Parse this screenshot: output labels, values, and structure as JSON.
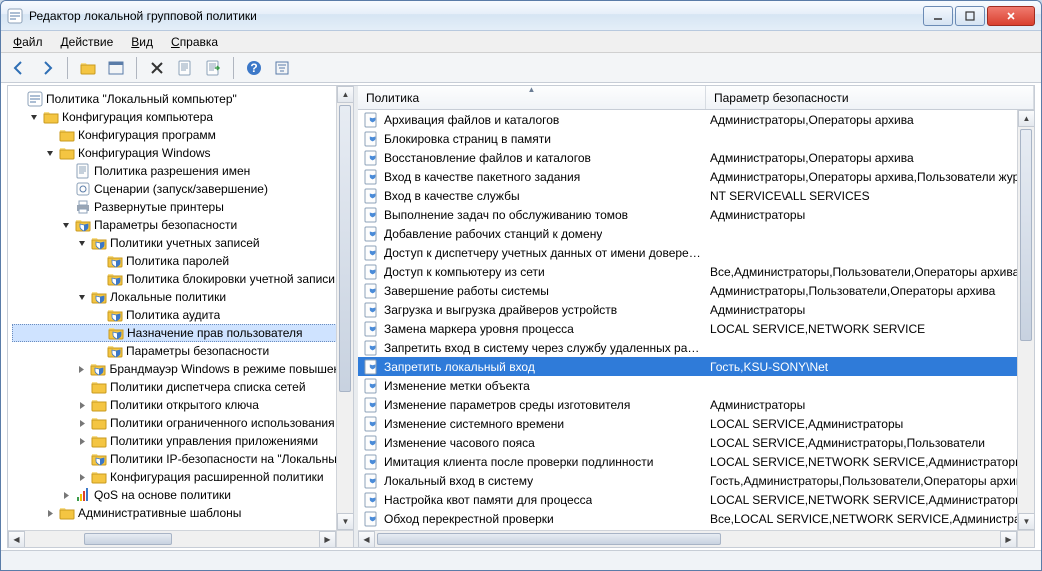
{
  "window": {
    "title": "Редактор локальной групповой политики"
  },
  "menu": {
    "file": "Файл",
    "action": "Действие",
    "view": "Вид",
    "help": "Справка"
  },
  "tree_root": "Политика \"Локальный компьютер\"",
  "tree": {
    "n0": "Конфигурация компьютера",
    "n1": "Конфигурация программ",
    "n2": "Конфигурация Windows",
    "n3": "Политика разрешения имен",
    "n4": "Сценарии (запуск/завершение)",
    "n5": "Развернутые принтеры",
    "n6": "Параметры безопасности",
    "n7": "Политики учетных записей",
    "n8": "Политика паролей",
    "n9": "Политика блокировки учетной записи",
    "n10": "Локальные политики",
    "n11": "Политика аудита",
    "n12": "Назначение прав пользователя",
    "n13": "Параметры безопасности",
    "n14": "Брандмауэр Windows в режиме повышенной",
    "n15": "Политики диспетчера списка сетей",
    "n16": "Политики открытого ключа",
    "n17": "Политики ограниченного использования",
    "n18": "Политики управления приложениями",
    "n19": "Политики IP-безопасности на \"Локальный",
    "n20": "Конфигурация расширенной политики",
    "n21": "QoS на основе политики",
    "n22": "Административные шаблоны"
  },
  "list_header": {
    "col1": "Политика",
    "col2": "Параметр безопасности"
  },
  "policies": [
    {
      "name": "Архивация файлов и каталогов",
      "param": "Администраторы,Операторы архива"
    },
    {
      "name": "Блокировка страниц в памяти",
      "param": ""
    },
    {
      "name": "Восстановление файлов и каталогов",
      "param": "Администраторы,Операторы архива"
    },
    {
      "name": "Вход в качестве пакетного задания",
      "param": "Администраторы,Операторы архива,Пользователи жур"
    },
    {
      "name": "Вход в качестве службы",
      "param": "NT SERVICE\\ALL SERVICES"
    },
    {
      "name": "Выполнение задач по обслуживанию томов",
      "param": "Администраторы"
    },
    {
      "name": "Добавление рабочих станций к домену",
      "param": ""
    },
    {
      "name": "Доступ к диспетчеру учетных данных от имени доверенн...",
      "param": ""
    },
    {
      "name": "Доступ к компьютеру из сети",
      "param": "Все,Администраторы,Пользователи,Операторы архива"
    },
    {
      "name": "Завершение работы системы",
      "param": "Администраторы,Пользователи,Операторы архива"
    },
    {
      "name": "Загрузка и выгрузка драйверов устройств",
      "param": "Администраторы"
    },
    {
      "name": "Замена маркера уровня процесса",
      "param": "LOCAL SERVICE,NETWORK SERVICE"
    },
    {
      "name": "Запретить вход в систему через службу удаленных рабоч...",
      "param": ""
    },
    {
      "name": "Запретить локальный вход",
      "param": "Гость,KSU-SONY\\Net",
      "selected": true
    },
    {
      "name": "Изменение метки объекта",
      "param": ""
    },
    {
      "name": "Изменение параметров среды изготовителя",
      "param": "Администраторы"
    },
    {
      "name": "Изменение системного времени",
      "param": "LOCAL SERVICE,Администраторы"
    },
    {
      "name": "Изменение часового пояса",
      "param": "LOCAL SERVICE,Администраторы,Пользователи"
    },
    {
      "name": "Имитация клиента после проверки подлинности",
      "param": "LOCAL SERVICE,NETWORK SERVICE,Администраторы,СЛУ"
    },
    {
      "name": "Локальный вход в систему",
      "param": "Гость,Администраторы,Пользователи,Операторы архив"
    },
    {
      "name": "Настройка квот памяти для процесса",
      "param": "LOCAL SERVICE,NETWORK SERVICE,Администраторы"
    },
    {
      "name": "Обход перекрестной проверки",
      "param": "Все,LOCAL SERVICE,NETWORK SERVICE,Администраторы"
    }
  ]
}
